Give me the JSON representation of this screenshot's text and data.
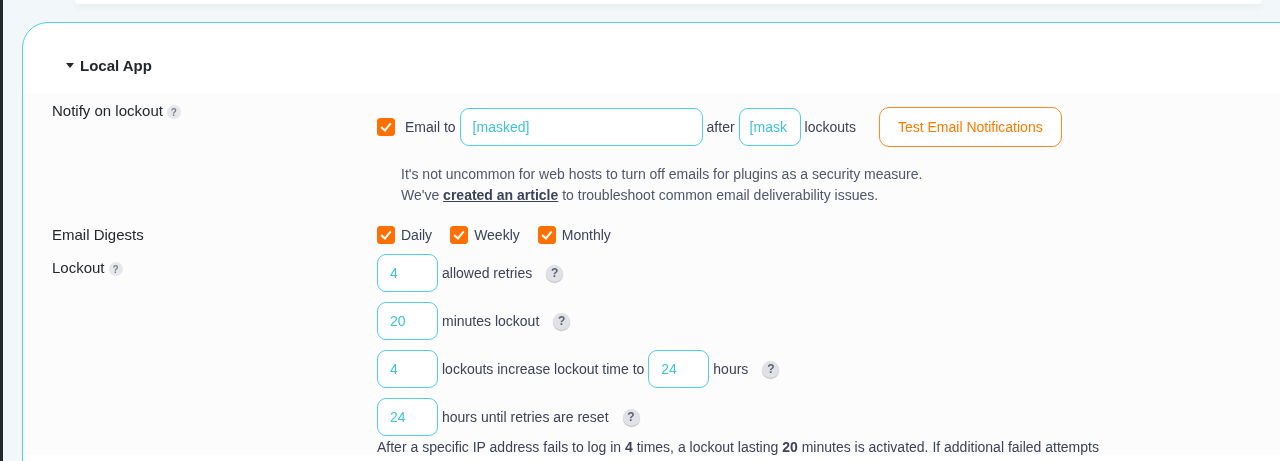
{
  "section": {
    "title": "Local App",
    "expanded": true
  },
  "notify": {
    "label": "Notify on lockout",
    "help": "?",
    "email_checked": true,
    "email_label": "Email to",
    "email": "[masked]",
    "after_label": "after",
    "lockouts_value": "[mask",
    "lockouts_label": "lockouts",
    "test_button": "Test Email Notifications",
    "note_1": "It's not uncommon for web hosts to turn off emails for plugins as a security measure.",
    "note_2_before": "We've",
    "note_2_link": "created an article",
    "note_2_after": "to troubleshoot common email deliverability issues."
  },
  "digests": {
    "label": "Email Digests",
    "options": [
      {
        "label": "Daily",
        "checked": true
      },
      {
        "label": "Weekly",
        "checked": true
      },
      {
        "label": "Monthly",
        "checked": true
      }
    ]
  },
  "lockout": {
    "label": "Lockout",
    "help": "?",
    "rows": [
      {
        "parts": [
          {
            "kind": "input",
            "text": "4"
          },
          {
            "kind": "text",
            "text": "allowed retries"
          },
          {
            "kind": "help",
            "text": "?"
          }
        ]
      },
      {
        "parts": [
          {
            "kind": "input",
            "text": "20"
          },
          {
            "kind": "text",
            "text": "minutes lockout"
          },
          {
            "kind": "help",
            "text": "?"
          }
        ]
      },
      {
        "parts": [
          {
            "kind": "input",
            "text": "4"
          },
          {
            "kind": "text",
            "text": "lockouts increase lockout time to"
          },
          {
            "kind": "input",
            "text": "24"
          },
          {
            "kind": "text",
            "text": "hours"
          },
          {
            "kind": "help",
            "text": "?"
          }
        ]
      },
      {
        "parts": [
          {
            "kind": "input",
            "text": "24"
          },
          {
            "kind": "text",
            "text": "hours until retries are reset"
          },
          {
            "kind": "help",
            "text": "?"
          }
        ]
      }
    ],
    "summary": "After a specific IP address fails to log in **4** times, a lockout lasting **20** minutes is activated. If additional failed attempts"
  }
}
